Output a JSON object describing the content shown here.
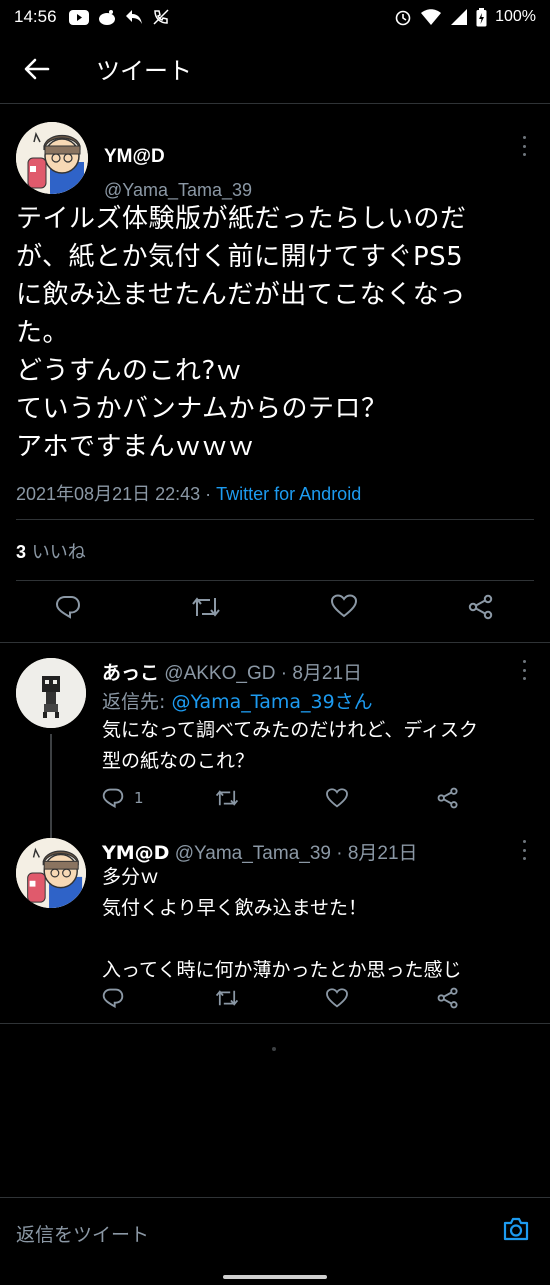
{
  "status_bar": {
    "time": "14:56",
    "battery": "100%"
  },
  "header": {
    "title": "ツイート"
  },
  "main_tweet": {
    "author_name": "YM@D",
    "author_handle": "@Yama_Tama_39",
    "text": "テイルズ体験版が紙だったらしいのだ\nが、紙とか気付く前に開けてすぐPS5\nに飲み込ませたんだが出てこなくなっ\nた。\nどうすんのこれ?ｗ\nていうかバンナムからのテロ？\nアホですまんｗｗｗ",
    "timestamp": "2021年08月21日 22:43 · ",
    "client": "Twitter for Android",
    "likes_count": "3",
    "likes_label": " いいね"
  },
  "replies": [
    {
      "name": "あっこ",
      "handle_date": " @AKKO_GD · 8月21日",
      "replying_label": "返信先: ",
      "replying_to": "@Yama_Tama_39さん",
      "text": "気になって調べてみたのだけれど、ディスク\n型の紙なのこれ？",
      "reply_count": "1"
    },
    {
      "name": "YM@D",
      "handle_date": " @Yama_Tama_39 · 8月21日",
      "text": "多分ｗ\n気付くより早く飲み込ませた！\n\n入ってく時に何か薄かったとか思った感じ"
    }
  ],
  "composer": {
    "placeholder": "返信をツイート"
  },
  "colors": {
    "background": "#000000",
    "accent": "#1d9bf0",
    "secondary_text": "#8b98a5",
    "divider": "#2f3336"
  },
  "icons": [
    "youtube-icon",
    "app-icon",
    "reply-notification-icon",
    "no-call-icon",
    "alarm-icon",
    "wifi-icon",
    "signal-icon",
    "battery-icon",
    "back-arrow-icon",
    "more-icon",
    "reply-icon",
    "retweet-icon",
    "like-icon",
    "share-icon",
    "camera-icon"
  ]
}
